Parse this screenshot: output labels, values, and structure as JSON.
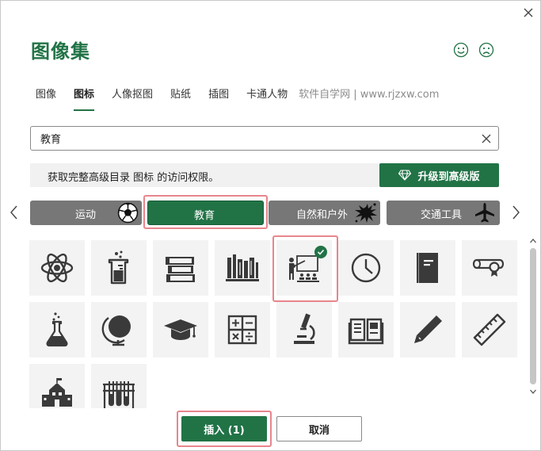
{
  "dialog": {
    "title": "图像集"
  },
  "tabs": [
    {
      "label": "图像",
      "active": false
    },
    {
      "label": "图标",
      "active": true
    },
    {
      "label": "人像抠图",
      "active": false
    },
    {
      "label": "贴纸",
      "active": false
    },
    {
      "label": "插图",
      "active": false
    },
    {
      "label": "卡通人物",
      "active": false
    }
  ],
  "watermark": "软件自学网 | www.rjzxw.com",
  "search": {
    "value": "教育",
    "placeholder": ""
  },
  "upgrade": {
    "message": "获取完整高级目录 图标 的访问权限。",
    "button_label": "升级到高级版"
  },
  "categories": [
    {
      "label": "运动",
      "icon": "soccer-ball-icon",
      "active": false
    },
    {
      "label": "教育",
      "icon": "",
      "active": true
    },
    {
      "label": "自然和户外",
      "icon": "splash-icon",
      "active": false
    },
    {
      "label": "交通工具",
      "icon": "airplane-icon",
      "active": false
    }
  ],
  "icons": [
    {
      "name": "atom-icon",
      "selected": false
    },
    {
      "name": "beaker-icon",
      "selected": false
    },
    {
      "name": "book-stack-icon",
      "selected": false
    },
    {
      "name": "bookshelf-icon",
      "selected": false
    },
    {
      "name": "teacher-classroom-icon",
      "selected": true
    },
    {
      "name": "clock-icon",
      "selected": false
    },
    {
      "name": "notebook-icon",
      "selected": false
    },
    {
      "name": "diploma-icon",
      "selected": false
    },
    {
      "name": "flask-icon",
      "selected": false
    },
    {
      "name": "globe-icon",
      "selected": false
    },
    {
      "name": "graduation-cap-icon",
      "selected": false
    },
    {
      "name": "calculator-icon",
      "selected": false
    },
    {
      "name": "microscope-icon",
      "selected": false
    },
    {
      "name": "open-book-icon",
      "selected": false
    },
    {
      "name": "pencil-icon",
      "selected": false
    },
    {
      "name": "ruler-icon",
      "selected": false
    },
    {
      "name": "school-icon",
      "selected": false
    },
    {
      "name": "test-tubes-icon",
      "selected": false
    }
  ],
  "footer": {
    "insert_label": "插入 (1)",
    "cancel_label": "取消"
  },
  "colors": {
    "accent": "#217346",
    "category_inactive": "#777777",
    "highlight": "#e8858d",
    "tile_bg": "#f3f3f3",
    "icon": "#3a3a3a"
  }
}
